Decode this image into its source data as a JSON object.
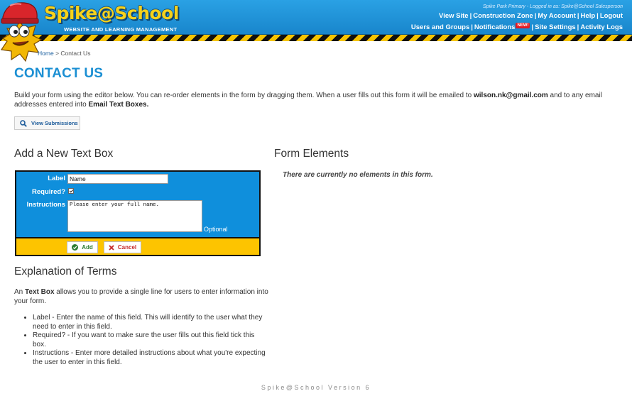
{
  "header": {
    "logo_text": "Spike@School",
    "logo_subtitle": "WEBSITE AND LEARNING MANAGEMENT",
    "login_info": "Spike Park Primary - Logged in as: Spike@School Salesperson",
    "nav_row1": [
      "View Site",
      "Construction Zone",
      "My Account",
      "Help",
      "Logout"
    ],
    "nav_row2": [
      "Users and Groups",
      "Notifications",
      "Site Settings",
      "Activity Logs"
    ],
    "new_badge": "NEW!",
    "separator": "|",
    "colors": {
      "header_blue": "#1b8fd3",
      "hazard_yellow": "#f5c400"
    }
  },
  "breadcrumb": {
    "home": "Home",
    "separator": ">",
    "current": "Contact Us"
  },
  "page_title": "CONTACT US",
  "intro": {
    "text_before_email": "Build your form using the editor below. You can re-order elements in the form by dragging them. When a user fills out this form it will be emailed to ",
    "email": "wilson.nk@gmail.com",
    "text_after_email": " and to any email addresses entered into ",
    "email_text_boxes": "Email Text Boxes."
  },
  "view_submissions_label": "View Submissions",
  "add_section": {
    "heading": "Add a New Text Box",
    "label_label": "Label",
    "label_value": "Name",
    "required_label": "Required?",
    "required_checked": true,
    "instructions_label": "Instructions",
    "instructions_value": "Please enter your full name.",
    "optional_label": "Optional",
    "add_button": "Add",
    "cancel_button": "Cancel"
  },
  "form_elements": {
    "heading": "Form Elements",
    "empty_message": "There are currently no elements in this form."
  },
  "explanation": {
    "heading": "Explanation of Terms",
    "para_prefix": "An ",
    "para_bold": "Text Box",
    "para_suffix": " allows you to provide a single line for users to enter information into your form.",
    "items": [
      "Label - Enter the name of this field. This will identify to the user what they need to enter in this field.",
      "Required? - If you want to make sure the user fills out this field tick this box.",
      "Instructions - Enter more detailed instructions about what you're expecting the user to enter in this field."
    ]
  },
  "footer": "Spike@School Version 6",
  "icons": {
    "view_submissions": "magnifier-icon",
    "add": "checkmark-circle-icon",
    "cancel": "x-icon",
    "mascot": "mascot-icon"
  }
}
